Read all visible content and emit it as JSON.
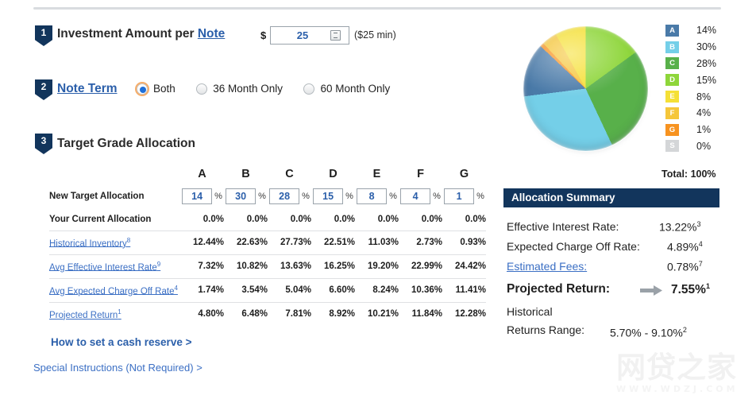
{
  "steps": {
    "one": {
      "number": "1",
      "title_prefix": "Investment Amount per ",
      "title_link": "Note"
    },
    "two": {
      "number": "2",
      "title_link": "Note Term"
    },
    "three": {
      "number": "3",
      "title": "Target Grade Allocation"
    }
  },
  "investment": {
    "currency_symbol": "$",
    "amount_value": "25",
    "amount_placeholder": "25",
    "min_note": "($25 min)",
    "stepper_icon": "spinner-icon"
  },
  "note_term": {
    "options": [
      {
        "label": "Both",
        "selected": true
      },
      {
        "label": "36 Month Only",
        "selected": false
      },
      {
        "label": "60 Month Only",
        "selected": false
      }
    ]
  },
  "grade_table": {
    "columns": [
      "A",
      "B",
      "C",
      "D",
      "E",
      "F",
      "G"
    ],
    "pct_mark": "%",
    "rows": [
      {
        "label": "New Target Allocation",
        "type": "input",
        "link": false,
        "sup": "",
        "values": [
          "14",
          "30",
          "28",
          "15",
          "8",
          "4",
          "1"
        ]
      },
      {
        "label": "Your Current Allocation",
        "type": "text",
        "link": false,
        "sup": "",
        "values": [
          "0.0%",
          "0.0%",
          "0.0%",
          "0.0%",
          "0.0%",
          "0.0%",
          "0.0%"
        ]
      },
      {
        "label": "Historical Inventory",
        "type": "text",
        "link": true,
        "sup": "8",
        "values": [
          "12.44%",
          "22.63%",
          "27.73%",
          "22.51%",
          "11.03%",
          "2.73%",
          "0.93%"
        ]
      },
      {
        "label": "Avg Effective Interest Rate",
        "type": "text",
        "link": true,
        "sup": "9",
        "values": [
          "7.32%",
          "10.82%",
          "13.63%",
          "16.25%",
          "19.20%",
          "22.99%",
          "24.42%"
        ]
      },
      {
        "label": "Avg Expected Charge Off Rate",
        "type": "text",
        "link": true,
        "sup": "4",
        "values": [
          "1.74%",
          "3.54%",
          "5.04%",
          "6.60%",
          "8.24%",
          "10.36%",
          "11.41%"
        ]
      },
      {
        "label": "Projected Return",
        "type": "text",
        "link": true,
        "sup": "1",
        "values": [
          "4.80%",
          "6.48%",
          "7.81%",
          "8.92%",
          "10.21%",
          "11.84%",
          "12.28%"
        ]
      }
    ]
  },
  "footer_links": {
    "cash_reserve": "How to set a cash reserve >",
    "special_instructions": "Special Instructions (Not Required) >"
  },
  "legend": {
    "total_label": "Total: 100%",
    "items": [
      {
        "grade": "A",
        "pct": "14%",
        "color": "#4a7aa8"
      },
      {
        "grade": "B",
        "pct": "30%",
        "color": "#74cfe8"
      },
      {
        "grade": "C",
        "pct": "28%",
        "color": "#58b04a"
      },
      {
        "grade": "D",
        "pct": "15%",
        "color": "#8ed63a"
      },
      {
        "grade": "E",
        "pct": "8%",
        "color": "#f5e036"
      },
      {
        "grade": "F",
        "pct": "4%",
        "color": "#f5c63a"
      },
      {
        "grade": "G",
        "pct": "1%",
        "color": "#f79320"
      },
      {
        "grade": "S",
        "pct": "0%",
        "color": "#d4d6d8"
      }
    ]
  },
  "summary": {
    "header": "Allocation Summary",
    "effective_interest_label": "Effective Interest Rate:",
    "effective_interest_value": "13.22%",
    "effective_interest_sup": "3",
    "charge_off_label": "Expected Charge Off Rate:",
    "charge_off_value": "4.89%",
    "charge_off_sup": "4",
    "fees_label": "Estimated Fees:",
    "fees_value": "0.78%",
    "fees_sup": "7",
    "projected_label": "Projected Return:",
    "projected_value": "7.55%",
    "projected_sup": "1",
    "historical_label": "Historical",
    "returns_range_label": "Returns Range:",
    "returns_range_value": "5.70% - 9.10%",
    "returns_range_sup": "2",
    "arrow_icon": "right-arrow-icon"
  },
  "watermark": {
    "cn": "网贷之家",
    "en": "WWW.WDZJ.COM"
  },
  "chart_data": {
    "type": "pie",
    "title": "",
    "legend_position": "right",
    "labels": [
      "A",
      "B",
      "C",
      "D",
      "E",
      "F",
      "G",
      "S"
    ],
    "values": [
      14,
      30,
      28,
      15,
      8,
      4,
      1,
      0
    ],
    "colors": [
      "#4a7aa8",
      "#74cfe8",
      "#58b04a",
      "#8ed63a",
      "#f5e036",
      "#f5c63a",
      "#f79320",
      "#d4d6d8"
    ],
    "units": "percent",
    "total": 100,
    "start_angle_deg": 0,
    "direction": "clockwise",
    "slice_order": [
      "D",
      "C",
      "B",
      "A",
      "G",
      "F",
      "E"
    ]
  }
}
